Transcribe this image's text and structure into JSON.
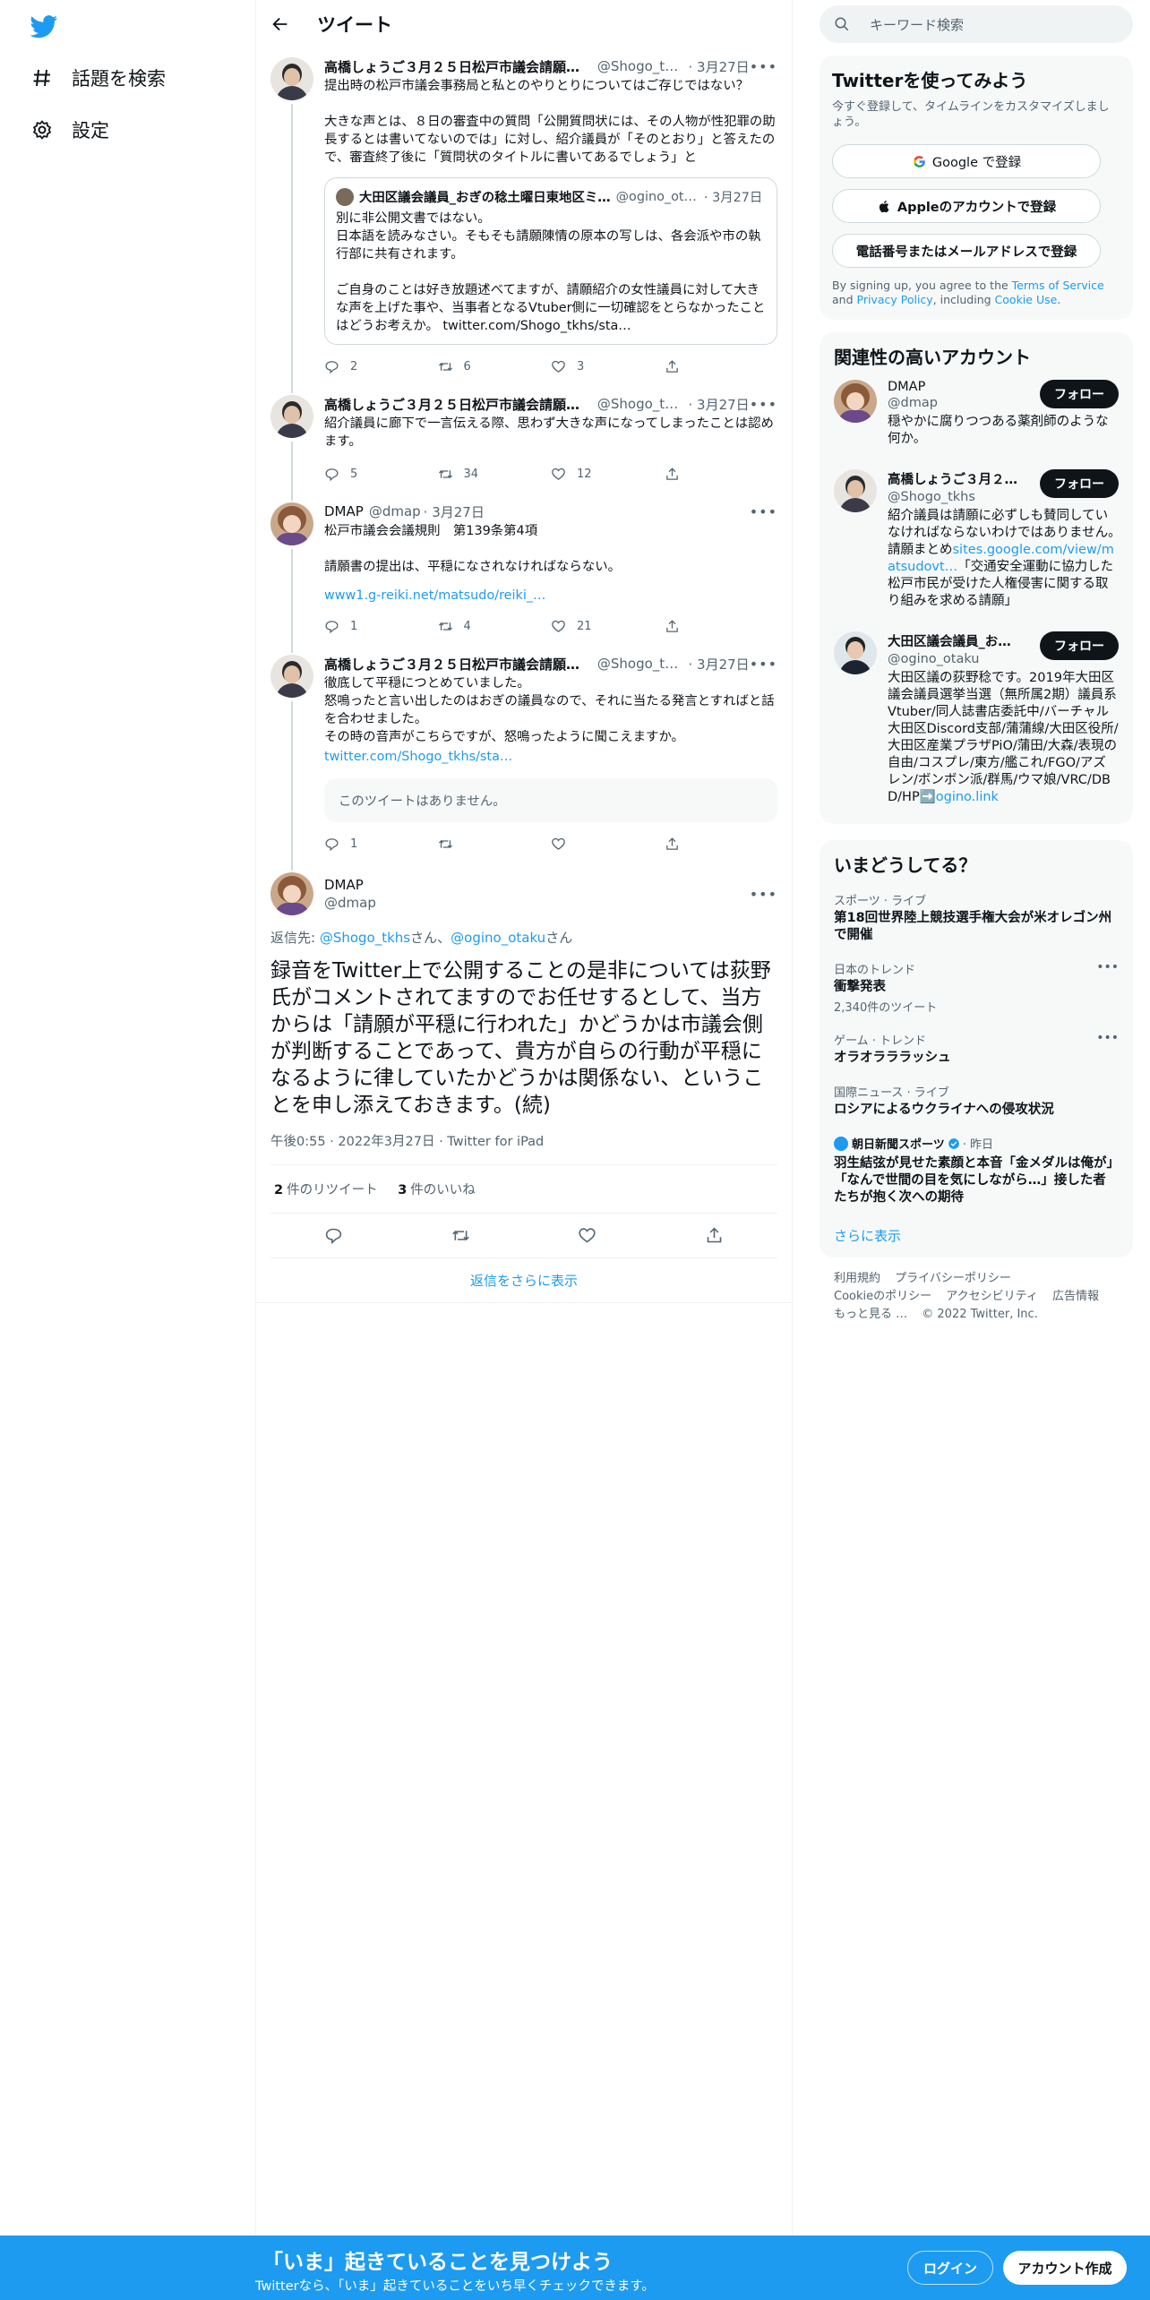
{
  "nav": {
    "explore_label": "話題を検索",
    "settings_label": "設定"
  },
  "header": {
    "title": "ツイート"
  },
  "tweets": [
    {
      "name": "高橋しょうご３月２５日松戸市議会請願審…",
      "handle": "@Shogo_tk…",
      "date": "· 3月27日",
      "text": "提出時の松戸市議会事務局と私とのやりとりについてはご存じではない？\n\n大きな声とは、８日の審査中の質問「公開質問状には、その人物が性犯罪の助長するとは書いてないのでは」に対し、紹介議員が「そのとおり」と答えたので、審査終了後に「質問状のタイトルに書いてあるでしょう」と",
      "quote": {
        "name": "大田区議会議員_おぎの稔土曜日東地区ミ…",
        "handle": "@ogino_ot…",
        "date": "· 3月27日",
        "text": "別に非公開文書ではない。\n日本語を読みなさい。そもそも請願陳情の原本の写しは、各会派や市の執行部に共有されます。\n\nご自身のことは好き放題述べてますが、請願紹介の女性議員に対して大きな声を上げた事や、当事者となるVtuber側に一切確認をとらなかったことはどうお考えか。 twitter.com/Shogo_tkhs/sta…"
      },
      "replies": "2",
      "retweets": "6",
      "likes": "3"
    },
    {
      "name": "高橋しょうご３月２５日松戸市議会請願審…",
      "handle": "@Shogo_tk…",
      "date": "· 3月27日",
      "text": "紹介議員に廊下で一言伝える際、思わず大きな声になってしまったことは認めます。",
      "replies": "5",
      "retweets": "34",
      "likes": "12"
    },
    {
      "name": "DMAP",
      "handle": "@dmap",
      "date": "· 3月27日",
      "text": "松戸市議会会議規則　第139条第4項\n\n請願書の提出は、平穏になされなければならない。",
      "link": "www1.g-reiki.net/matsudo/reiki_…",
      "replies": "1",
      "retweets": "4",
      "likes": "21"
    },
    {
      "name": "高橋しょうご３月２５日松戸市議会請願審…",
      "handle": "@Shogo_tk…",
      "date": "· 3月27日",
      "text": "徹底して平穏につとめていました。\n怒鳴ったと言い出したのはおぎの議員なので、それに当たる発言とすればと話を合わせました。\nその時の音声がこちらですが、怒鳴ったように聞こえますか。",
      "link": "twitter.com/Shogo_tkhs/sta…",
      "unavailable": "このツイートはありません。",
      "replies": "1",
      "retweets": "",
      "likes": ""
    }
  ],
  "focus": {
    "name": "DMAP",
    "handle": "@dmap",
    "reply_prefix": "返信先: ",
    "reply_user1": "@Shogo_tkhs",
    "reply_san1": "さん、",
    "reply_user2": "@ogino_otaku",
    "reply_san2": "さん",
    "text": "録音をTwitter上で公開することの是非については荻野氏がコメントされてますのでお任せするとして、当方からは「請願が平穏に行われた」かどうかは市議会側が判断することであって、貴方が自らの行動が平穏になるように律していたかどうかは関係ない、ということを申し添えておきます。(続)",
    "meta": "午後0:55 · 2022年3月27日 · Twitter for iPad",
    "retweet_count": "2",
    "retweet_label": "件のリツイート",
    "like_count": "3",
    "like_label": "件のいいね",
    "more_replies": "返信をさらに表示"
  },
  "right": {
    "search_placeholder": "キーワード検索",
    "signup": {
      "title": "Twitterを使ってみよう",
      "sub": "今すぐ登録して、タイムラインをカスタマイズしましょう。",
      "google": "Google で登録",
      "apple": "Appleのアカウントで登録",
      "phone": "電話番号またはメールアドレスで登録",
      "terms_pre": "By signing up, you agree to the ",
      "terms_link": "Terms of Service",
      "terms_and": " and ",
      "privacy_link": "Privacy Policy",
      "terms_inc": ", including ",
      "cookie_link": "Cookie Use",
      "terms_end": "."
    },
    "relevant": {
      "title": "関連性の高いアカウント",
      "follow": "フォロー",
      "accounts": [
        {
          "name": "DMAP",
          "handle": "@dmap",
          "bio": "穏やかに腐りつつある薬剤師のような何か。"
        },
        {
          "name": "高橋しょうご３月２…",
          "handle": "@Shogo_tkhs",
          "bio_pre": "紹介議員は請願に必ずしも賛同していなければならないわけではありません。　　請願まとめ",
          "bio_link": "sites.google.com/view/matsudovt…",
          "bio_post": "「交通安全運動に協力した松戸市民が受けた人権侵害に関する取り組みを求める請願」"
        },
        {
          "name": "大田区議会議員_お…",
          "handle": "@ogino_otaku",
          "bio_pre": "大田区議の荻野稔です。2019年大田区議会議員選挙当選（無所属2期）議員系Vtuber/同人誌書店委託中/バーチャル大田区Discord支部/蒲蒲線/大田区役所/大田区産業プラザPiO/蒲田/大森/表現の自由/コスプレ/東方/艦これ/FGO/アズレン/ボンボン派/群馬/ウマ娘/VRC/DBD/HP➡️",
          "bio_link": "ogino.link"
        }
      ]
    },
    "trends": {
      "title": "いまどうしてる？",
      "items": [
        {
          "cat": "スポーツ · ライブ",
          "title": "第18回世界陸上競技選手権大会が米オレゴン州で開催"
        },
        {
          "cat": "日本のトレンド",
          "title": "衝撃発表",
          "count": "2,340件のツイート"
        },
        {
          "cat": "ゲーム · トレンド",
          "title": "オラオラララッシュ"
        },
        {
          "cat": "国際ニュース · ライブ",
          "title": "ロシアによるウクライナへの侵攻状況"
        }
      ],
      "news": {
        "source": "朝日新聞スポーツ",
        "date": "· 昨日",
        "title": "羽生結弦が見せた素顔と本音「金メダルは俺が」「なんで世間の目を気にしながら…」接した者たちが抱く次への期待"
      },
      "show_more": "さらに表示"
    },
    "footer": {
      "links": [
        "利用規約",
        "プライバシーポリシー",
        "Cookieのポリシー",
        "アクセシビリティ",
        "広告情報",
        "もっと見る …",
        "© 2022 Twitter, Inc."
      ]
    }
  },
  "banner": {
    "title": "「いま」起きていることを見つけよう",
    "sub": "Twitterなら、「いま」起きていることをいち早くチェックできます。",
    "login": "ログイン",
    "signup": "アカウント作成"
  },
  "colors": {
    "accent": "#1d9bf0",
    "text": "#0f1419",
    "muted": "#536471"
  }
}
